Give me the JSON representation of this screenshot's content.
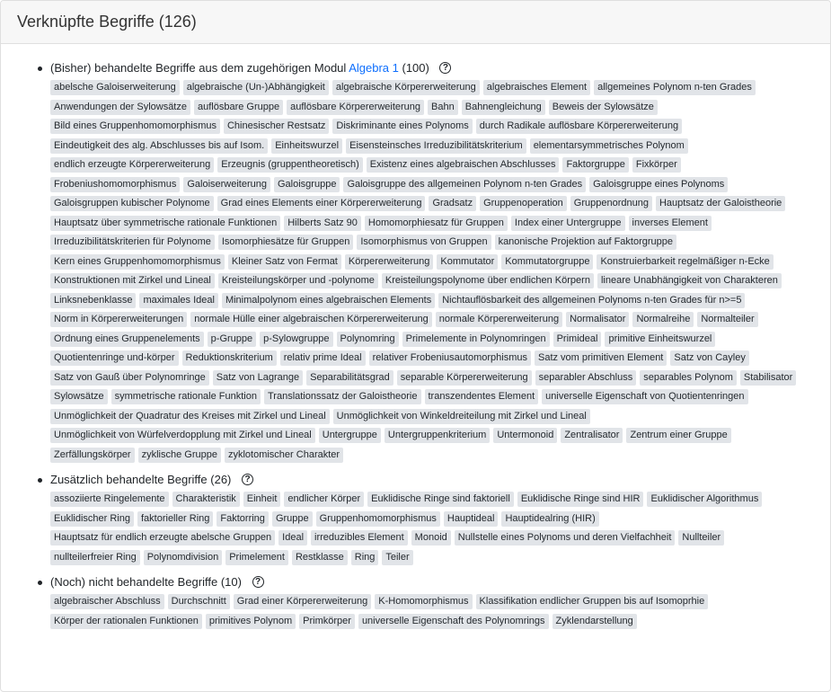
{
  "header": {
    "title": "Verknüpfte Begriffe (126)"
  },
  "help_icon_glyph": "?",
  "sections": [
    {
      "prefix": "(Bisher) behandelte Begriffe aus dem zugehörigen Modul",
      "link": "Algebra 1",
      "suffix": "(100)",
      "tags": [
        "abelsche Galoiserweiterung",
        "algebraische (Un-)Abhängigkeit",
        "algebraische Körpererweiterung",
        "algebraisches Element",
        "allgemeines Polynom n-ten Grades",
        "Anwendungen der Sylowsätze",
        "auflösbare Gruppe",
        "auflösbare Körpererweiterung",
        "Bahn",
        "Bahnengleichung",
        "Beweis der Sylowsätze",
        "Bild eines Gruppenhomomorphismus",
        "Chinesischer Restsatz",
        "Diskriminante eines Polynoms",
        "durch Radikale auflösbare Körpererweiterung",
        "Eindeutigkeit des alg. Abschlusses bis auf Isom.",
        "Einheitswurzel",
        "Eisensteinsches Irreduzibilitätskriterium",
        "elementarsymmetrisches Polynom",
        "endlich erzeugte Körpererweiterung",
        "Erzeugnis (gruppentheoretisch)",
        "Existenz eines algebraischen Abschlusses",
        "Faktorgruppe",
        "Fixkörper",
        "Frobeniushomomorphismus",
        "Galoiserweiterung",
        "Galoisgruppe",
        "Galoisgruppe des allgemeinen Polynom n-ten Grades",
        "Galoisgruppe eines Polynoms",
        "Galoisgruppen kubischer Polynome",
        "Grad eines Elements einer Körpererweiterung",
        "Gradsatz",
        "Gruppenoperation",
        "Gruppenordnung",
        "Hauptsatz der Galoistheorie",
        "Hauptsatz über symmetrische rationale Funktionen",
        "Hilberts Satz 90",
        "Homomorphiesatz für Gruppen",
        "Index einer Untergruppe",
        "inverses Element",
        "Irreduzibilitätskriterien für Polynome",
        "Isomorphiesätze für Gruppen",
        "Isomorphismus von Gruppen",
        "kanonische Projektion auf Faktorgruppe",
        "Kern eines Gruppenhomomorphismus",
        "Kleiner Satz von Fermat",
        "Körpererweiterung",
        "Kommutator",
        "Kommutatorgruppe",
        "Konstruierbarkeit regelmäßiger n-Ecke",
        "Konstruktionen mit Zirkel und Lineal",
        "Kreisteilungskörper und -polynome",
        "Kreisteilungspolynome über endlichen Körpern",
        "lineare Unabhängigkeit von Charakteren",
        "Linksnebenklasse",
        "maximales Ideal",
        "Minimalpolynom eines algebraischen Elements",
        "Nichtauflösbarkeit des allgemeinen Polynoms n-ten Grades für n>=5",
        "Norm in Körpererweiterungen",
        "normale Hülle einer algebraischen Körpererweiterung",
        "normale Körpererweiterung",
        "Normalisator",
        "Normalreihe",
        "Normalteiler",
        "Ordnung eines Gruppenelements",
        "p-Gruppe",
        "p-Sylowgruppe",
        "Polynomring",
        "Primelemente in Polynomringen",
        "Primideal",
        "primitive Einheitswurzel",
        "Quotientenringe und-körper",
        "Reduktionskriterium",
        "relativ prime Ideal",
        "relativer Frobeniusautomorphismus",
        "Satz vom primitiven Element",
        "Satz von Cayley",
        "Satz von Gauß über Polynomringe",
        "Satz von Lagrange",
        "Separabilitätsgrad",
        "separable Körpererweiterung",
        "separabler Abschluss",
        "separables Polynom",
        "Stabilisator",
        "Sylowsätze",
        "symmetrische rationale Funktion",
        "Translationssatz der Galoistheorie",
        "transzendentes Element",
        "universelle Eigenschaft von Quotientenringen",
        "Unmöglichkeit der Quadratur des Kreises mit Zirkel und Lineal",
        "Unmöglichkeit von Winkeldreiteilung mit Zirkel und Lineal",
        "Unmöglichkeit von Würfelverdopplung mit Zirkel und Lineal",
        "Untergruppe",
        "Untergruppenkriterium",
        "Untermonoid",
        "Zentralisator",
        "Zentrum einer Gruppe",
        "Zerfällungskörper",
        "zyklische Gruppe",
        "zyklotomischer Charakter"
      ]
    },
    {
      "prefix": "Zusätzlich behandelte Begriffe (26)",
      "link": "",
      "suffix": "",
      "tags": [
        "assoziierte Ringelemente",
        "Charakteristik",
        "Einheit",
        "endlicher Körper",
        "Euklidische Ringe sind faktoriell",
        "Euklidische Ringe sind HIR",
        "Euklidischer Algorithmus",
        "Euklidischer Ring",
        "faktorieller Ring",
        "Faktorring",
        "Gruppe",
        "Gruppenhomomorphismus",
        "Hauptideal",
        "Hauptidealring (HIR)",
        "Hauptsatz für endlich erzeugte abelsche Gruppen",
        "Ideal",
        "irreduzibles Element",
        "Monoid",
        "Nullstelle eines Polynoms und deren Vielfachheit",
        "Nullteiler",
        "nullteilerfreier Ring",
        "Polynomdivision",
        "Primelement",
        "Restklasse",
        "Ring",
        "Teiler"
      ]
    },
    {
      "prefix": "(Noch) nicht behandelte Begriffe (10)",
      "link": "",
      "suffix": "",
      "tags": [
        "algebraischer Abschluss",
        "Durchschnitt",
        "Grad einer Körpererweiterung",
        "K-Homomorphismus",
        "Klassifikation endlicher Gruppen bis auf Isomoprhie",
        "Körper der rationalen Funktionen",
        "primitives Polynom",
        "Primkörper",
        "universelle Eigenschaft des Polynomrings",
        "Zyklendarstellung"
      ]
    }
  ]
}
